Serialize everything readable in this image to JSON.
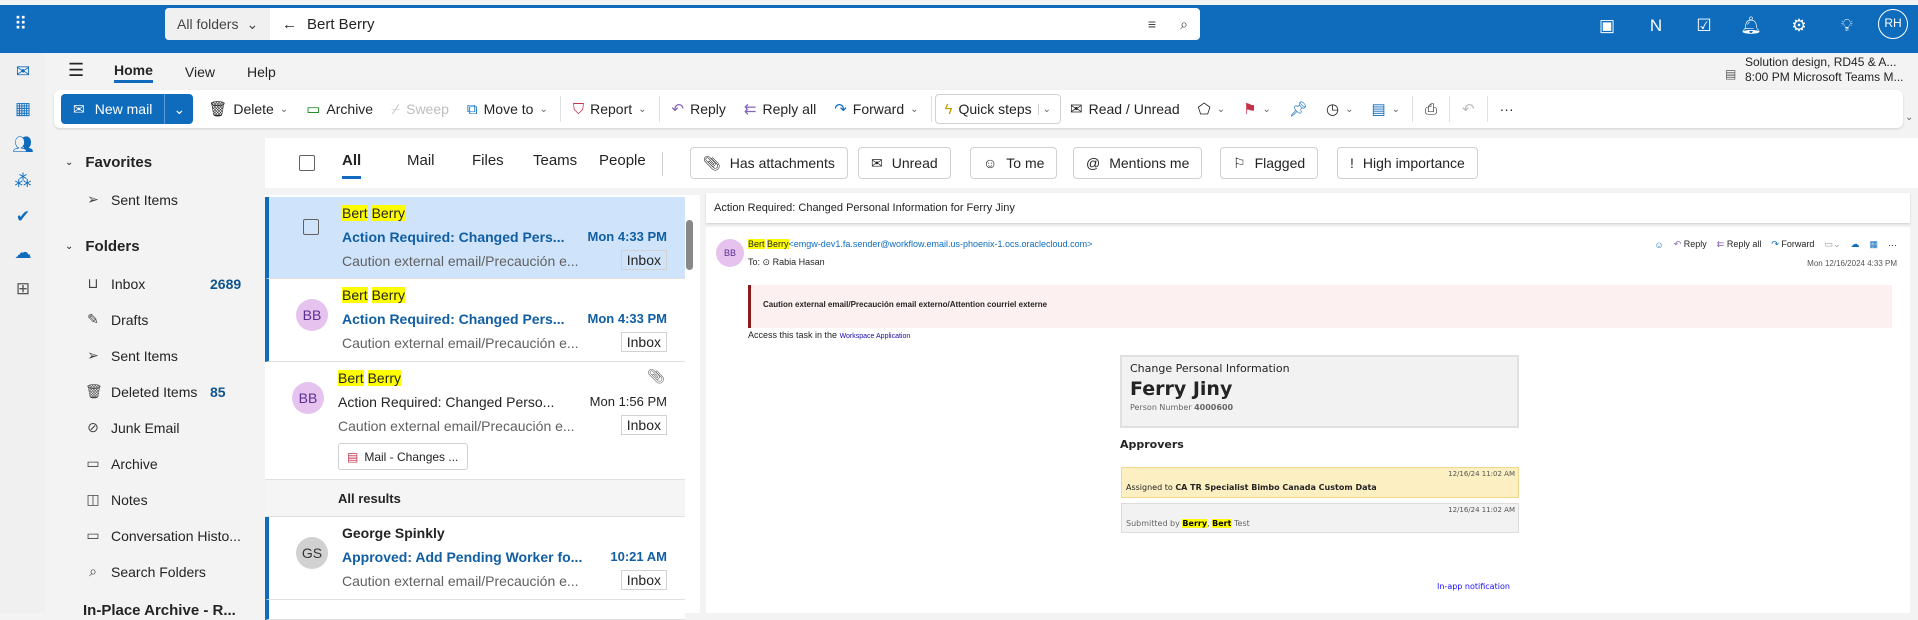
{
  "header": {
    "search_scope": "All folders",
    "search_query": "Bert Berry",
    "user_initials": "RH"
  },
  "ribbon": {
    "tabs": [
      "Home",
      "View",
      "Help"
    ],
    "meeting_title": "Solution design, RD45 & A...",
    "meeting_detail": "8:00 PM Microsoft Teams M..."
  },
  "toolbar": {
    "new_mail": "New mail",
    "delete": "Delete",
    "archive": "Archive",
    "sweep": "Sweep",
    "move_to": "Move to",
    "report": "Report",
    "reply": "Reply",
    "reply_all": "Reply all",
    "forward": "Forward",
    "quick_steps": "Quick steps",
    "read_unread": "Read / Unread",
    "more": "···"
  },
  "folders": {
    "favorites": "Favorites",
    "folders": "Folders",
    "fav_items": [
      {
        "label": "Sent Items"
      }
    ],
    "items": [
      {
        "label": "Inbox",
        "count": "2689"
      },
      {
        "label": "Drafts"
      },
      {
        "label": "Sent Items"
      },
      {
        "label": "Deleted Items",
        "count": "85"
      },
      {
        "label": "Junk Email"
      },
      {
        "label": "Archive"
      },
      {
        "label": "Notes"
      },
      {
        "label": "Conversation Histo..."
      },
      {
        "label": "Search Folders"
      }
    ],
    "archive_section": "In-Place Archive - R..."
  },
  "filters": {
    "tabs": [
      "All",
      "Mail",
      "Files",
      "Teams",
      "People"
    ],
    "chips": [
      "Has attachments",
      "Unread",
      "To me",
      "Mentions me",
      "Flagged",
      "High importance"
    ]
  },
  "messages": [
    {
      "sender_first": "Bert",
      "sender_last": "Berry",
      "subject": "Action Required: Changed Pers...",
      "time": "Mon 4:33 PM",
      "preview": "Caution external email/Precaución e...",
      "folder": "Inbox"
    },
    {
      "initials": "BB",
      "sender_first": "Bert",
      "sender_last": "Berry",
      "subject": "Action Required: Changed Pers...",
      "time": "Mon 4:33 PM",
      "preview": "Caution external email/Precaución e...",
      "folder": "Inbox"
    },
    {
      "initials": "BB",
      "sender_first": "Bert",
      "sender_last": "Berry",
      "subject": "Action Required: Changed Perso...",
      "time": "Mon 1:56 PM",
      "preview": "Caution external email/Precaución e...",
      "folder": "Inbox",
      "attachment": "Mail - Changes ..."
    },
    {
      "initials": "GS",
      "sender": "George Spinkly",
      "subject": "Approved: Add Pending Worker fo...",
      "time": "10:21 AM",
      "preview": "Caution external email/Precaución e...",
      "folder": "Inbox"
    }
  ],
  "all_results": "All results",
  "reading": {
    "subject": "Action Required: Changed Personal Information for Ferry Jiny",
    "initials": "BB",
    "sender_first": "Bert",
    "sender_last": "Berry",
    "sender_email": "<emgw-dev1.fa.sender@workflow.email.us-phoenix-1.ocs.oraclecloud.com>",
    "to_label": "To:",
    "to": "Rabia Hasan",
    "date": "Mon 12/16/2024 4:33 PM",
    "reply": "Reply",
    "reply_all": "Reply all",
    "forward": "Forward",
    "caution": "Caution external email/Precaución email externo/Attention courriel externe",
    "access_text": "Access this task in the",
    "access_link": "Workspace Application",
    "card_title": "Change Personal Information",
    "person": "Ferry Jiny",
    "person_number_label": "Person Number",
    "person_number": "4000600",
    "approvers": "Approvers",
    "assigned_time": "12/16/24 11:02 AM",
    "assigned_prefix": "Assigned to",
    "assigned_to": "CA TR  Specialist Bimbo Canada Custom Data",
    "submitted_time": "12/16/24 11:02 AM",
    "submitted_prefix": "Submitted by",
    "submitted_last": "Berry",
    "submitted_first": "Bert",
    "submitted_suffix": "Test",
    "footer_link": "In-app notification"
  }
}
